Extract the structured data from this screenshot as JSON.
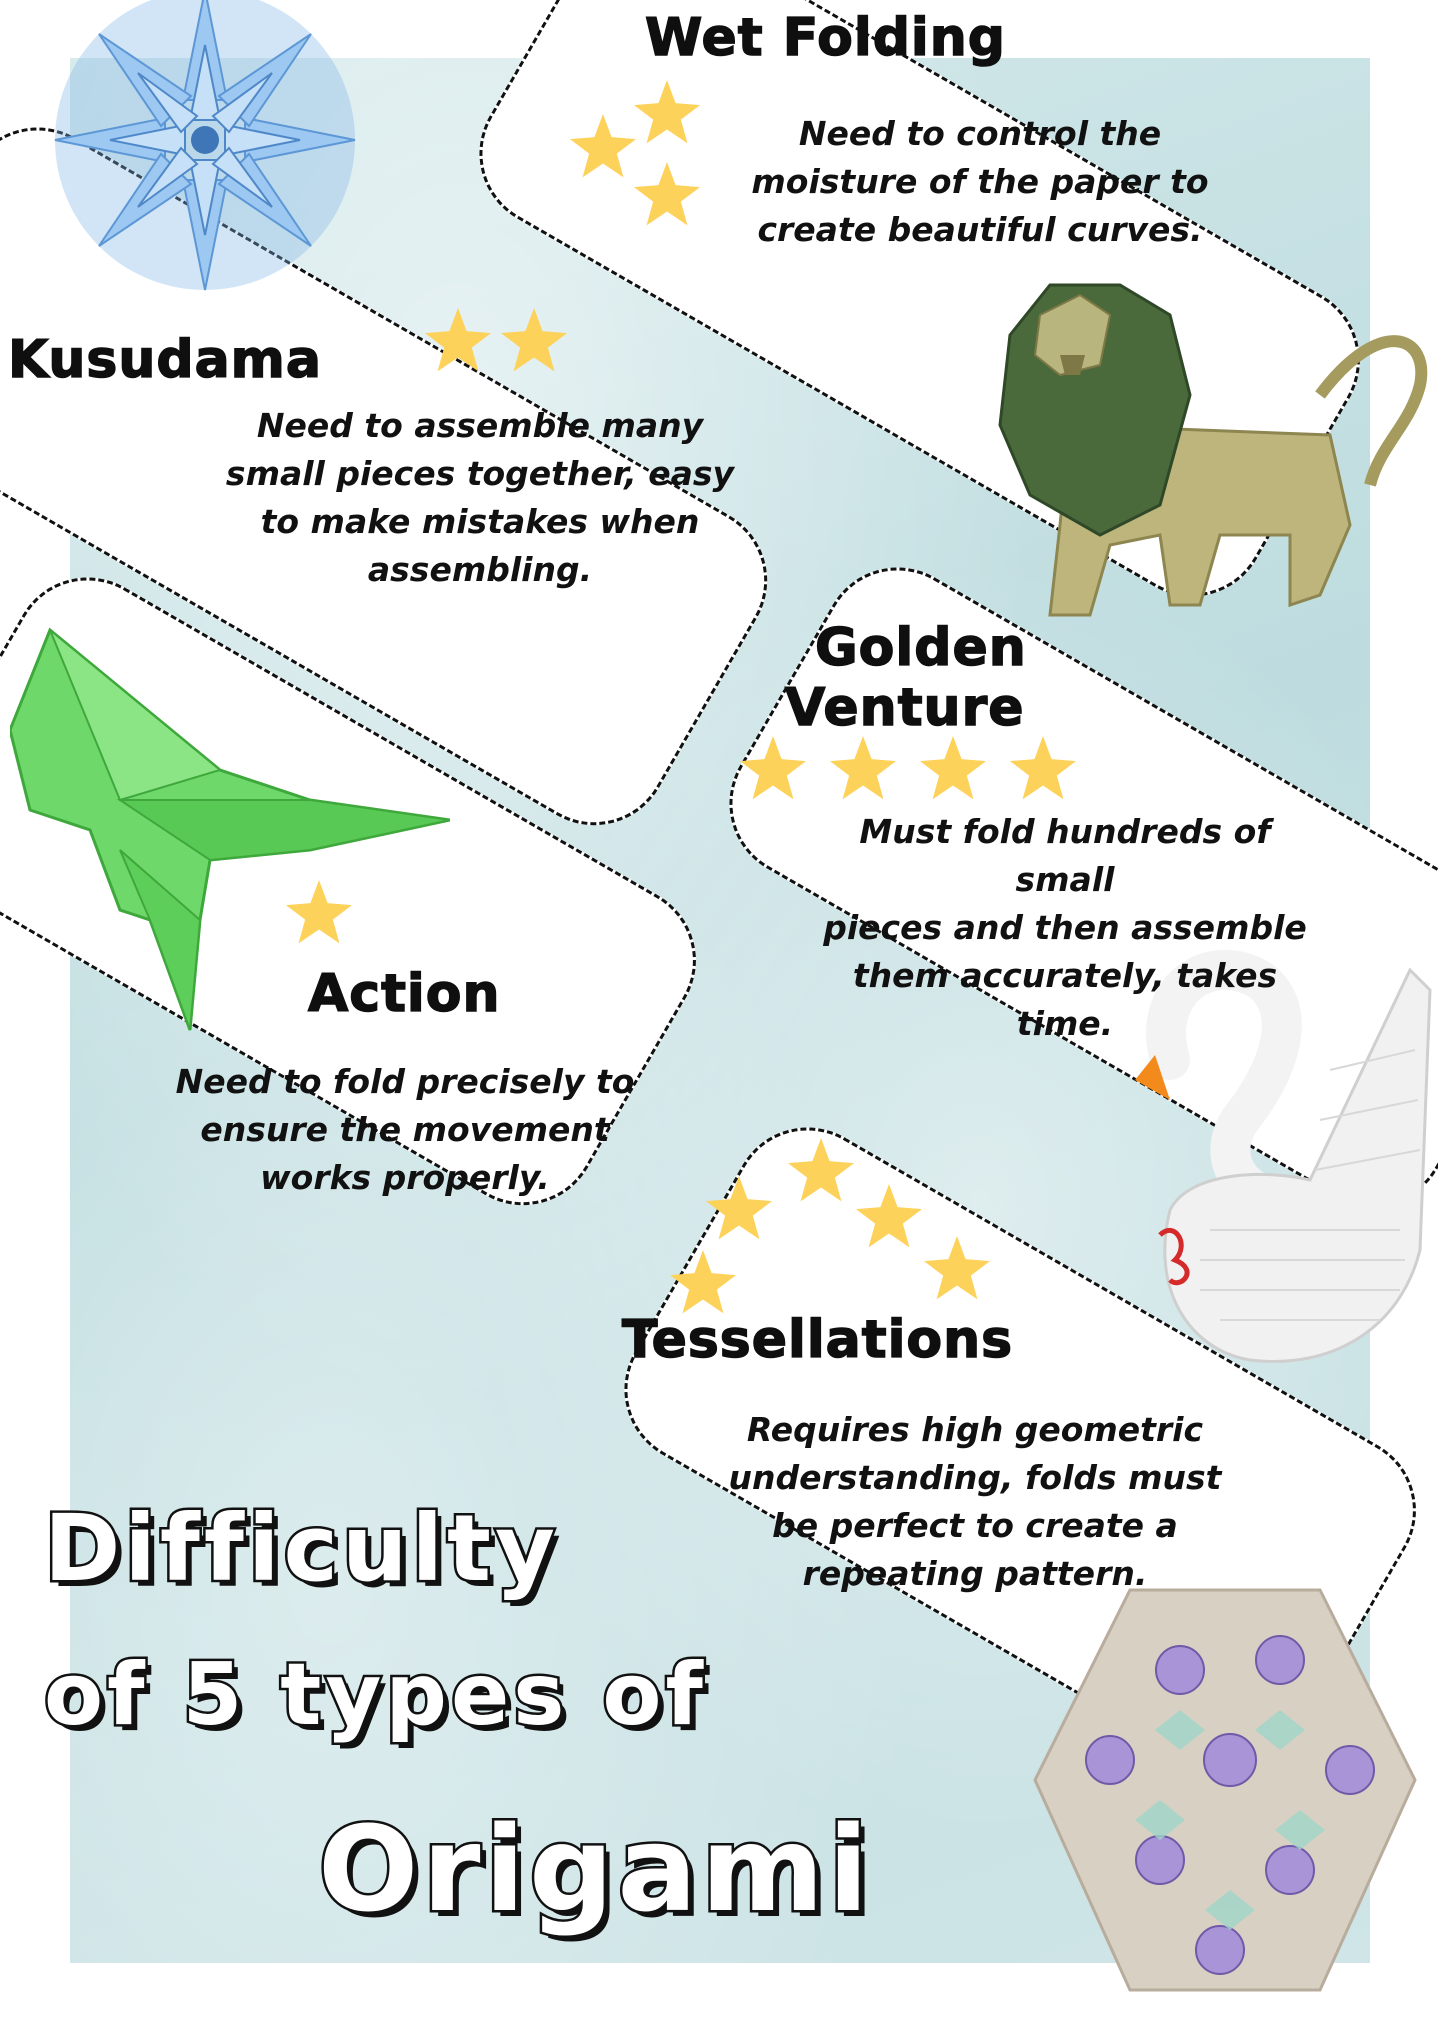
{
  "title": {
    "line1": "Difficulty",
    "line2": "of 5 types of",
    "line3": "Origami"
  },
  "colors": {
    "star": "#fdd25a",
    "background": "#c9e2e4",
    "card": "#ffffff",
    "text": "#111111"
  },
  "types": [
    {
      "id": "wet-folding",
      "name": "Wet Folding",
      "stars": 3,
      "description": [
        "Need to control the",
        "moisture of the paper to",
        "create beautiful curves."
      ],
      "image": "origami-lion"
    },
    {
      "id": "kusudama",
      "name": "Kusudama",
      "stars": 2,
      "description": [
        "Need to assemble many",
        "small pieces together, easy",
        "to make mistakes when",
        "assembling."
      ],
      "image": "kusudama-ball"
    },
    {
      "id": "golden-venture",
      "name": "Golden Venture",
      "name_lines": [
        "Golden",
        "Venture"
      ],
      "stars": 4,
      "description": [
        "Must fold hundreds of small",
        "pieces and then assemble",
        "them accurately, takes",
        "time."
      ],
      "image": "origami-swan"
    },
    {
      "id": "action",
      "name": "Action",
      "stars": 1,
      "description": [
        "Need to fold precisely to",
        "ensure the movement",
        "works properly."
      ],
      "image": "origami-frog"
    },
    {
      "id": "tessellations",
      "name": "Tessellations",
      "stars": 5,
      "description": [
        "Requires high geometric",
        "understanding, folds must",
        "be perfect to create a",
        "repeating pattern."
      ],
      "image": "tessellation-pattern"
    }
  ]
}
